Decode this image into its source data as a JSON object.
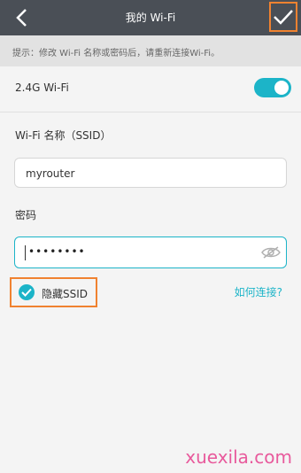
{
  "header": {
    "title": "我的 Wi-Fi"
  },
  "tip": {
    "text": "提示：修改 Wi-Fi 名称或密码后，请重新连接Wi-Fi。"
  },
  "band": {
    "label": "2.4G Wi-Fi",
    "enabled": true
  },
  "ssid": {
    "label": "Wi-Fi 名称（SSID）",
    "value": "myrouter"
  },
  "password": {
    "label": "密码",
    "masked_value": "••••••••"
  },
  "hide_ssid": {
    "label": "隐藏SSID",
    "checked": true
  },
  "help_link": {
    "label": "如何连接?"
  },
  "watermark": {
    "text": "xuexila.com"
  },
  "colors": {
    "header_bg": "#4a4f56",
    "accent": "#1cb4c8",
    "highlight_border": "#f08230",
    "watermark": "#e85a9c"
  }
}
